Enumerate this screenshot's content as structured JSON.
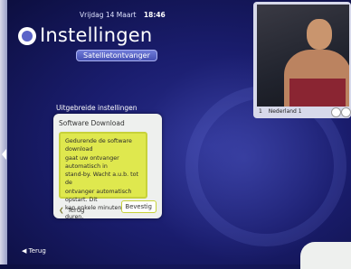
{
  "header": {
    "date": "Vrijdag 14 Maart",
    "time": "18:46",
    "title": "Instellingen",
    "subtitle": "Satellietontvanger"
  },
  "section": {
    "heading": "Uitgebreide instellingen"
  },
  "dialog": {
    "title": "Software Download",
    "message_lines": [
      "Gedurende de software download",
      "gaat uw ontvanger automatisch in",
      "stand-by. Wacht a.u.b. tot de",
      "ontvanger automatisch opstart. Dit",
      "kan enkele minuten duren."
    ],
    "back_label": "Terug",
    "confirm_label": "Bevestig"
  },
  "footer": {
    "back_label": "Terug"
  },
  "tv_preview": {
    "channel_number": "1",
    "channel_name": "Nederland 1"
  },
  "colors": {
    "background": "#1a1d6e",
    "accent_pill": "#4651b4",
    "dialog_highlight": "#dfe84e"
  }
}
